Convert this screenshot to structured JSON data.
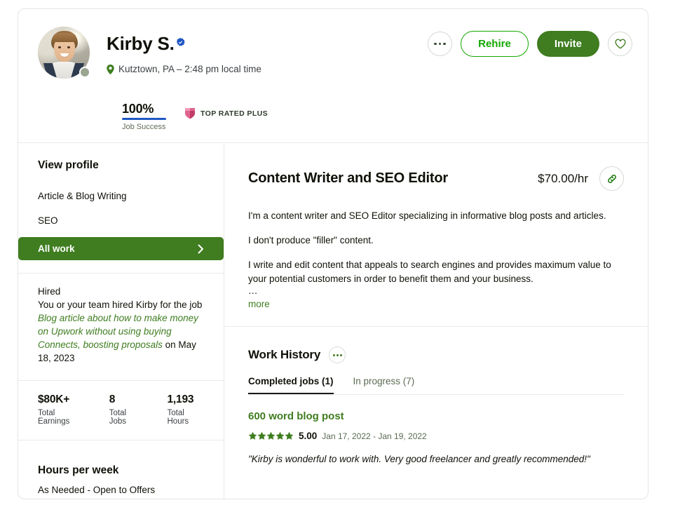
{
  "freelancer": {
    "name": "Kirby S.",
    "verified_icon": "verified-badge-icon",
    "location_icon": "map-pin-icon",
    "location": "Kutztown, PA – 2:48 pm local time",
    "job_success_percent": "100%",
    "job_success_label": "Job Success",
    "badge_icon": "shield-icon",
    "badge_label": "TOP RATED PLUS",
    "status_icon": "online-status-dot"
  },
  "header_actions": {
    "more_icon": "ellipsis-icon",
    "rehire_label": "Rehire",
    "invite_label": "Invite",
    "favorite_icon": "heart-icon"
  },
  "sidebar": {
    "title": "View profile",
    "items": [
      {
        "label": "Article & Blog Writing",
        "active": false
      },
      {
        "label": "SEO",
        "active": false
      },
      {
        "label": "All work",
        "active": true,
        "chevron_icon": "chevron-right-icon"
      }
    ],
    "hired": {
      "title": "Hired",
      "text_before": "You or your team hired Kirby for the job",
      "job_link": "Blog article about how to make money on Upwork without using buying Connects, boosting proposals",
      "text_after": "on May 18, 2023"
    },
    "stats": [
      {
        "value": "$80K+",
        "label": "Total Earnings"
      },
      {
        "value": "8",
        "label": "Total Jobs"
      },
      {
        "value": "1,193",
        "label": "Total Hours"
      }
    ],
    "hours_per_week": {
      "title": "Hours per week",
      "value": "As Needed - Open to Offers"
    }
  },
  "main": {
    "job_title": "Content Writer and SEO Editor",
    "rate": "$70.00/hr",
    "link_icon": "link-icon",
    "description_paragraphs": [
      "I'm a content writer and SEO Editor specializing in informative blog posts and articles.",
      "I don't produce \"filler\" content.",
      "I write and edit content that appeals to search engines and provides maximum value to your potential customers in order to benefit them and your business."
    ],
    "truncation_ellipsis": "…",
    "more_label": "more",
    "work_history": {
      "title": "Work History",
      "more_icon": "ellipsis-icon",
      "tabs": [
        {
          "label": "Completed jobs (1)",
          "active": true
        },
        {
          "label": "In progress (7)",
          "active": false
        }
      ],
      "entries": [
        {
          "title": "600 word blog post",
          "rating": "5.00",
          "stars": 5,
          "dates": "Jan 17, 2022 - Jan 19, 2022",
          "feedback": "\"Kirby is wonderful to work with. Very good freelancer and greatly recommended!\""
        }
      ]
    }
  },
  "colors": {
    "brand_green": "#14a800",
    "dark_green": "#3f7d20",
    "verified_blue": "#1f57c3",
    "badge_pink": "#e0648c"
  }
}
